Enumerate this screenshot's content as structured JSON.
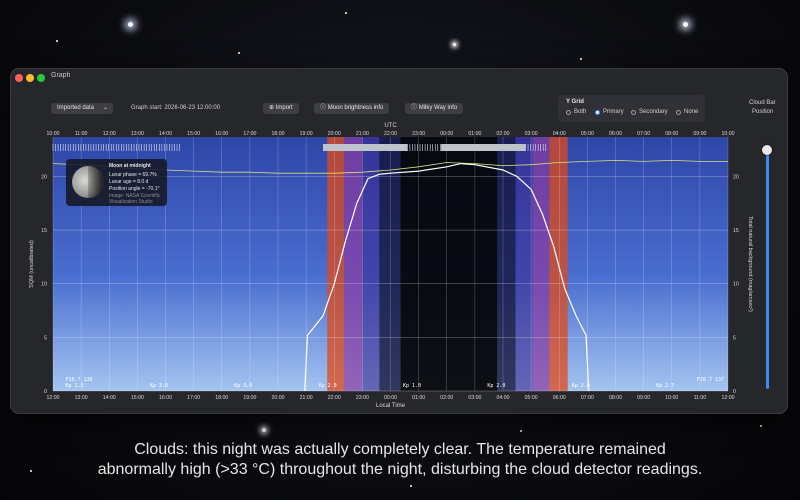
{
  "window": {
    "title": "Graph"
  },
  "toolbar": {
    "dropdown_value": "Imported data",
    "graph_start": "Graph start: 2026-06-23 12:00:00",
    "import_label": "Import",
    "moon_info_label": "Moon brightness info",
    "milky_way_label": "Milky Way info"
  },
  "ygrid": {
    "title": "Y Grid",
    "options": [
      "Both",
      "Primary",
      "Secondary",
      "None"
    ],
    "selected": "Primary"
  },
  "cloud_bar": {
    "label_line1": "Cloud Bar",
    "label_line2": "Position"
  },
  "tooltip": {
    "title": "Moon at midnight",
    "phase": "Lunar phase = 69.7%",
    "age": "Lunar age = 8.0 d",
    "angle": "Position angle = -70.1°",
    "credit1": "Image: NASA Scientific",
    "credit2": "Visualization Studio"
  },
  "chart_data": {
    "type": "line",
    "top_axis_label": "UTC",
    "bottom_axis_label": "Local Time",
    "ylabel": "SQM (uncalibrated)",
    "y2label": "Total natural background (mag/arcsec²)",
    "utc_ticks": [
      "10:00",
      "11:00",
      "12:00",
      "13:00",
      "14:00",
      "15:00",
      "16:00",
      "17:00",
      "18:00",
      "19:00",
      "20:00",
      "21:00",
      "22:00",
      "23:00",
      "00:00",
      "01:00",
      "02:00",
      "03:00",
      "04:00",
      "05:00",
      "06:00",
      "07:00",
      "08:00",
      "09:00",
      "10:00"
    ],
    "local_ticks": [
      "12:00",
      "13:00",
      "14:00",
      "15:00",
      "16:00",
      "17:00",
      "18:00",
      "19:00",
      "20:00",
      "21:00",
      "22:00",
      "23:00",
      "00:00",
      "01:00",
      "02:00",
      "03:00",
      "04:00",
      "05:00",
      "06:00",
      "07:00",
      "08:00",
      "09:00",
      "10:00",
      "11:00",
      "12:00"
    ],
    "ylim": [
      0,
      22
    ],
    "yticks": [
      0,
      5,
      10,
      15,
      20
    ],
    "y2ticks": [
      0,
      5,
      10,
      15,
      20
    ],
    "grid": true,
    "bottom_annotations": [
      {
        "hour": 0.3,
        "text": "F10.7 138"
      },
      {
        "hour": 0.3,
        "text": "Kp 1.3"
      },
      {
        "hour": 3.3,
        "text": "Kp 3.0"
      },
      {
        "hour": 6.3,
        "text": "Kp 3.0"
      },
      {
        "hour": 9.3,
        "text": "Kp 2.0"
      },
      {
        "hour": 12.3,
        "text": "Kp 1.0"
      },
      {
        "hour": 15.3,
        "text": "Kp 2.0"
      },
      {
        "hour": 18.3,
        "text": "Kp 2.0"
      },
      {
        "hour": 21.3,
        "text": "Kp 2.7"
      },
      {
        "hour": 23.0,
        "text": "F10.7 137"
      }
    ],
    "bands": [
      {
        "start": 9.75,
        "end": 10.35,
        "color": "#e04a18",
        "opacity": 0.75
      },
      {
        "start": 10.35,
        "end": 11.0,
        "color": "#8a3aa0",
        "opacity": 0.7
      },
      {
        "start": 11.0,
        "end": 11.6,
        "color": "#3a2a90",
        "opacity": 0.6
      },
      {
        "start": 11.6,
        "end": 12.35,
        "color": "#14143a",
        "opacity": 0.8
      },
      {
        "start": 12.35,
        "end": 15.8,
        "color": "#050508",
        "opacity": 0.95
      },
      {
        "start": 15.8,
        "end": 16.45,
        "color": "#14143a",
        "opacity": 0.8
      },
      {
        "start": 16.45,
        "end": 17.05,
        "color": "#3a2a90",
        "opacity": 0.6
      },
      {
        "start": 17.05,
        "end": 17.65,
        "color": "#8a3aa0",
        "opacity": 0.7
      },
      {
        "start": 17.65,
        "end": 18.3,
        "color": "#e04a18",
        "opacity": 0.75
      }
    ],
    "series": [
      {
        "color": "#ffffff",
        "x": [
          0,
          8.95,
          9.05,
          9.6,
          10.0,
          10.4,
          10.8,
          11.2,
          11.6,
          12.0,
          13.0,
          14.0,
          14.5,
          15.0,
          16.0,
          16.5,
          17.0,
          17.4,
          17.8,
          18.2,
          18.6,
          18.95,
          19.05
        ],
        "y": [
          null,
          0,
          5.2,
          7.0,
          10.0,
          14.0,
          17.5,
          19.8,
          20.2,
          20.3,
          20.5,
          20.9,
          21.2,
          21.1,
          20.6,
          20.0,
          18.8,
          16.5,
          13.5,
          9.5,
          7.0,
          5.2,
          0
        ]
      },
      {
        "color": "#d8e07a",
        "x": [
          0,
          1,
          2,
          3,
          4,
          5,
          6,
          7,
          8,
          9,
          10,
          11,
          12,
          13,
          14,
          15,
          16,
          17,
          18,
          19,
          20,
          21,
          22,
          23,
          24
        ],
        "y": [
          21.2,
          21.1,
          20.9,
          20.7,
          20.6,
          20.5,
          20.4,
          20.4,
          20.3,
          20.3,
          20.3,
          20.4,
          20.6,
          20.9,
          21.3,
          21.2,
          21.0,
          21.1,
          21.3,
          21.4,
          21.5,
          21.4,
          21.5,
          21.4,
          21.4
        ]
      }
    ],
    "cloud_strip": [
      {
        "start": 0.0,
        "end": 4.5,
        "type": "ticks"
      },
      {
        "start": 9.6,
        "end": 12.6,
        "type": "solid"
      },
      {
        "start": 12.6,
        "end": 13.8,
        "type": "ticks"
      },
      {
        "start": 13.8,
        "end": 16.8,
        "type": "solid"
      },
      {
        "start": 16.8,
        "end": 17.6,
        "type": "ticks"
      }
    ]
  },
  "caption": {
    "line1": "Clouds: this night was actually completely clear. The temperature remained",
    "line2": "abnormally high (>33 °C) throughout the night, disturbing the cloud detector readings."
  }
}
